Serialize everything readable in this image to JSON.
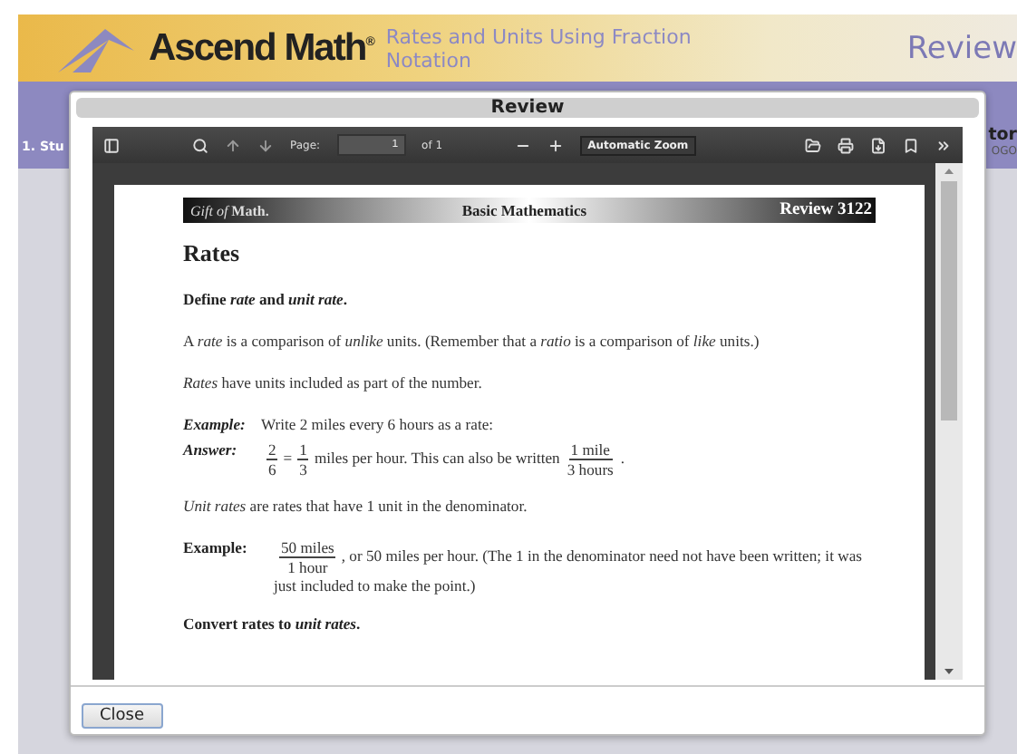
{
  "header": {
    "brand": "Ascend Math",
    "brand_mark": "®",
    "lesson_title": "Rates and Units Using Fraction Notation",
    "section": "Review"
  },
  "nav_band": {
    "left_text": "1. Stu",
    "right_text": "tor",
    "right_subtext": "OGO"
  },
  "dialog": {
    "title": "Review",
    "toolbar": {
      "page_label": "Page:",
      "page_value": "1",
      "page_count": "of 1",
      "zoom": "Automatic Zoom"
    },
    "document": {
      "brand": "*Gift of* **Math.**",
      "subject": "Basic Mathematics",
      "code": "Review 3122",
      "title": "Rates",
      "blocks": [
        {
          "kind": "heading",
          "text": "Define *rate* and *unit rate*."
        },
        {
          "kind": "para",
          "text": "A *rate* is a comparison of *unlike* units.  (Remember that a *ratio* is a comparison of *like* units.)"
        },
        {
          "kind": "para",
          "text": "*Rates* have units included as part of the number."
        },
        {
          "kind": "labeled",
          "label_italic": true,
          "label": "Example:",
          "segments": [
            {
              "kind": "text",
              "text": "Write 2 miles every 6 hours as a rate:"
            }
          ]
        },
        {
          "kind": "labeled",
          "label_italic": true,
          "label": "Answer:",
          "segments": [
            {
              "kind": "frac",
              "num": "2",
              "den": "6"
            },
            {
              "kind": "text",
              "text": "="
            },
            {
              "kind": "frac",
              "num": "1",
              "den": "3"
            },
            {
              "kind": "text",
              "text": "miles per hour.  This can also be written"
            },
            {
              "kind": "frac",
              "num": "1 mile",
              "den": "3 hours"
            },
            {
              "kind": "text",
              "text": "."
            }
          ]
        },
        {
          "kind": "para",
          "text": "*Unit rates* are rates that have 1 unit in the denominator."
        },
        {
          "kind": "labeled",
          "label_italic": false,
          "label": "Example:",
          "segments": [
            {
              "kind": "frac",
              "num": "50 miles",
              "den": "1 hour"
            },
            {
              "kind": "text",
              "text": ", or 50 miles per hour.  (The 1 in the denominator need not have been written; it was just included to make the point.)"
            }
          ]
        },
        {
          "kind": "heading",
          "text": "Convert rates to *unit rates*."
        }
      ]
    },
    "close_button": "Close"
  }
}
